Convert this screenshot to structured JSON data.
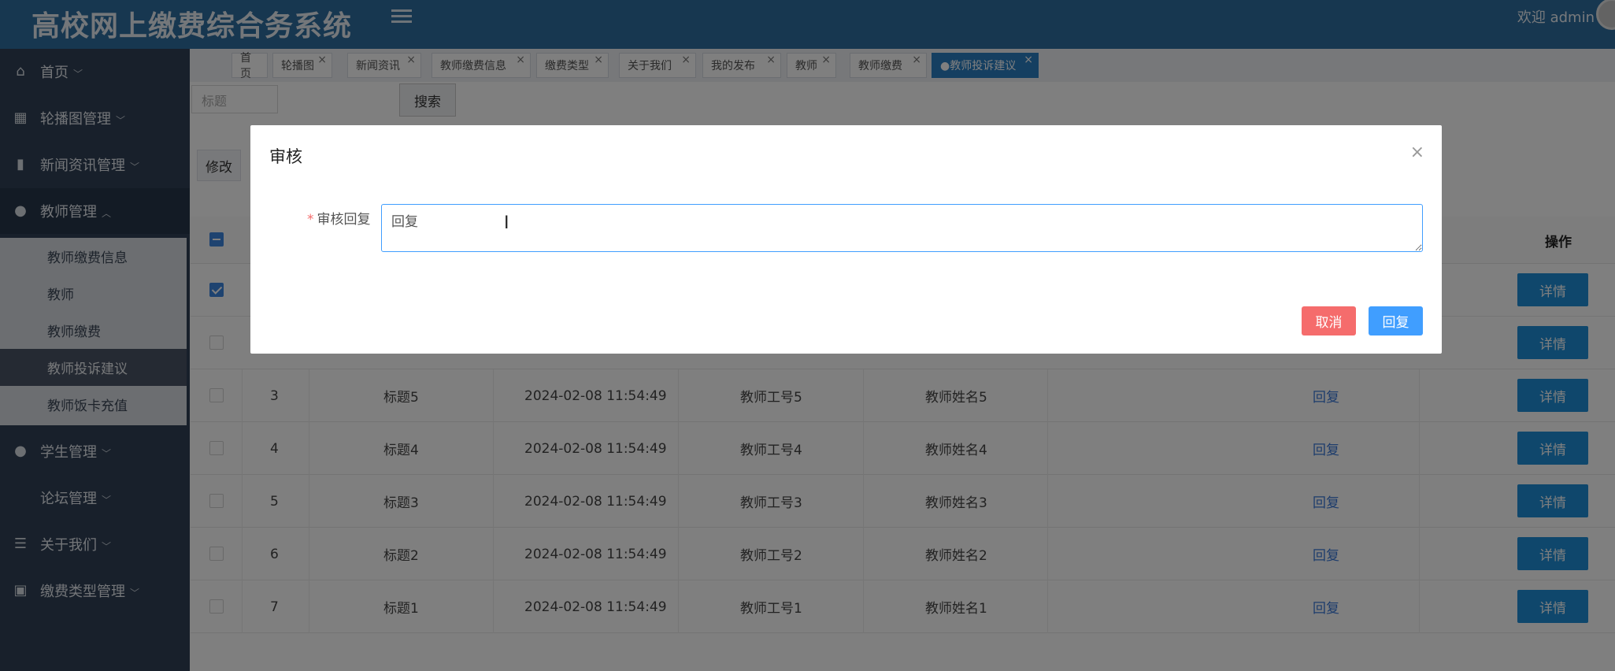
{
  "header": {
    "title": "高校网上缴费综合务系统",
    "welcome": "欢迎 admin"
  },
  "sidebar": {
    "items": [
      {
        "label": "首页",
        "icon": "home-icon"
      },
      {
        "label": "轮播图管理",
        "icon": "image-icon"
      },
      {
        "label": "新闻资讯管理",
        "icon": "bookmark-icon"
      },
      {
        "label": "教师管理",
        "icon": "user-icon"
      },
      {
        "label": "学生管理",
        "icon": "user-icon"
      },
      {
        "label": "论坛管理",
        "icon": ""
      },
      {
        "label": "关于我们",
        "icon": "list-icon"
      },
      {
        "label": "缴费类型管理",
        "icon": "badge-icon"
      }
    ],
    "submenu": [
      "教师缴费信息",
      "教师",
      "教师缴费",
      "教师投诉建议",
      "教师饭卡充值"
    ]
  },
  "tabs": [
    "首页",
    "轮播图",
    "新闻资讯",
    "教师缴费信息",
    "缴费类型",
    "关于我们",
    "我的发布",
    "教师",
    "教师缴费",
    "●教师投诉建议"
  ],
  "toolbar": {
    "search_placeholder": "标题",
    "search_label": "搜索",
    "edit_label": "修改"
  },
  "table": {
    "ops_header": "操作",
    "reply_label": "回复",
    "detail_label": "详情",
    "rows": [
      {
        "index": "3",
        "title": "标题5",
        "time": "2024-02-08 11:54:49",
        "teacher_id": "教师工号5",
        "teacher_name": "教师姓名5"
      },
      {
        "index": "4",
        "title": "标题4",
        "time": "2024-02-08 11:54:49",
        "teacher_id": "教师工号4",
        "teacher_name": "教师姓名4"
      },
      {
        "index": "5",
        "title": "标题3",
        "time": "2024-02-08 11:54:49",
        "teacher_id": "教师工号3",
        "teacher_name": "教师姓名3"
      },
      {
        "index": "6",
        "title": "标题2",
        "time": "2024-02-08 11:54:49",
        "teacher_id": "教师工号2",
        "teacher_name": "教师姓名2"
      },
      {
        "index": "7",
        "title": "标题1",
        "time": "2024-02-08 11:54:49",
        "teacher_id": "教师工号1",
        "teacher_name": "教师姓名1"
      }
    ]
  },
  "modal": {
    "title": "审核",
    "field_label": "审核回复",
    "required_mark": "*",
    "reply_value": "回复",
    "cancel_label": "取消",
    "confirm_label": "回复"
  }
}
